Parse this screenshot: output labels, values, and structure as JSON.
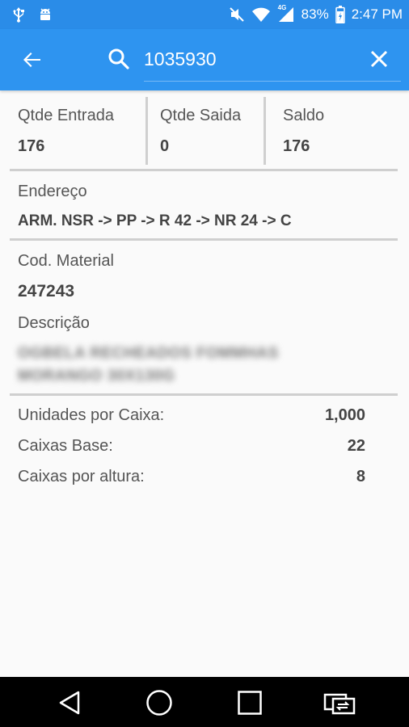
{
  "status_bar": {
    "icons": [
      "usb-icon",
      "android-debug-icon",
      "mute-icon",
      "wifi-icon",
      "signal-icon",
      "battery-icon"
    ],
    "network_label": "4G",
    "battery": "83%",
    "time": "2:47 PM"
  },
  "app_bar": {
    "search_value": "1035930",
    "search_placeholder": "",
    "color": "#2e94f0"
  },
  "quantities": {
    "entrada_label": "Qtde Entrada",
    "entrada_value": "176",
    "saida_label": "Qtde Saida",
    "saida_value": "0",
    "saldo_label": "Saldo",
    "saldo_value": "176"
  },
  "address": {
    "label": "Endereço",
    "value": "ARM. NSR -> PP -> R 42 -> NR 24 -> C"
  },
  "material": {
    "code_label": "Cod. Material",
    "code_value": "247243",
    "description_label": "Descrição",
    "description_line1": "OGBELA RECHEADOS FOMMHAS",
    "description_line2": "MORANGO 30X130G"
  },
  "packaging": {
    "unidades_label": "Unidades por Caixa:",
    "unidades_value": "1,000",
    "caixas_base_label": "Caixas Base:",
    "caixas_base_value": "22",
    "caixas_altura_label": "Caixas por altura:",
    "caixas_altura_value": "8"
  },
  "nav_bar": {
    "icons": [
      "back-triangle-icon",
      "home-circle-icon",
      "recents-square-icon",
      "screen-mirror-icon"
    ]
  }
}
